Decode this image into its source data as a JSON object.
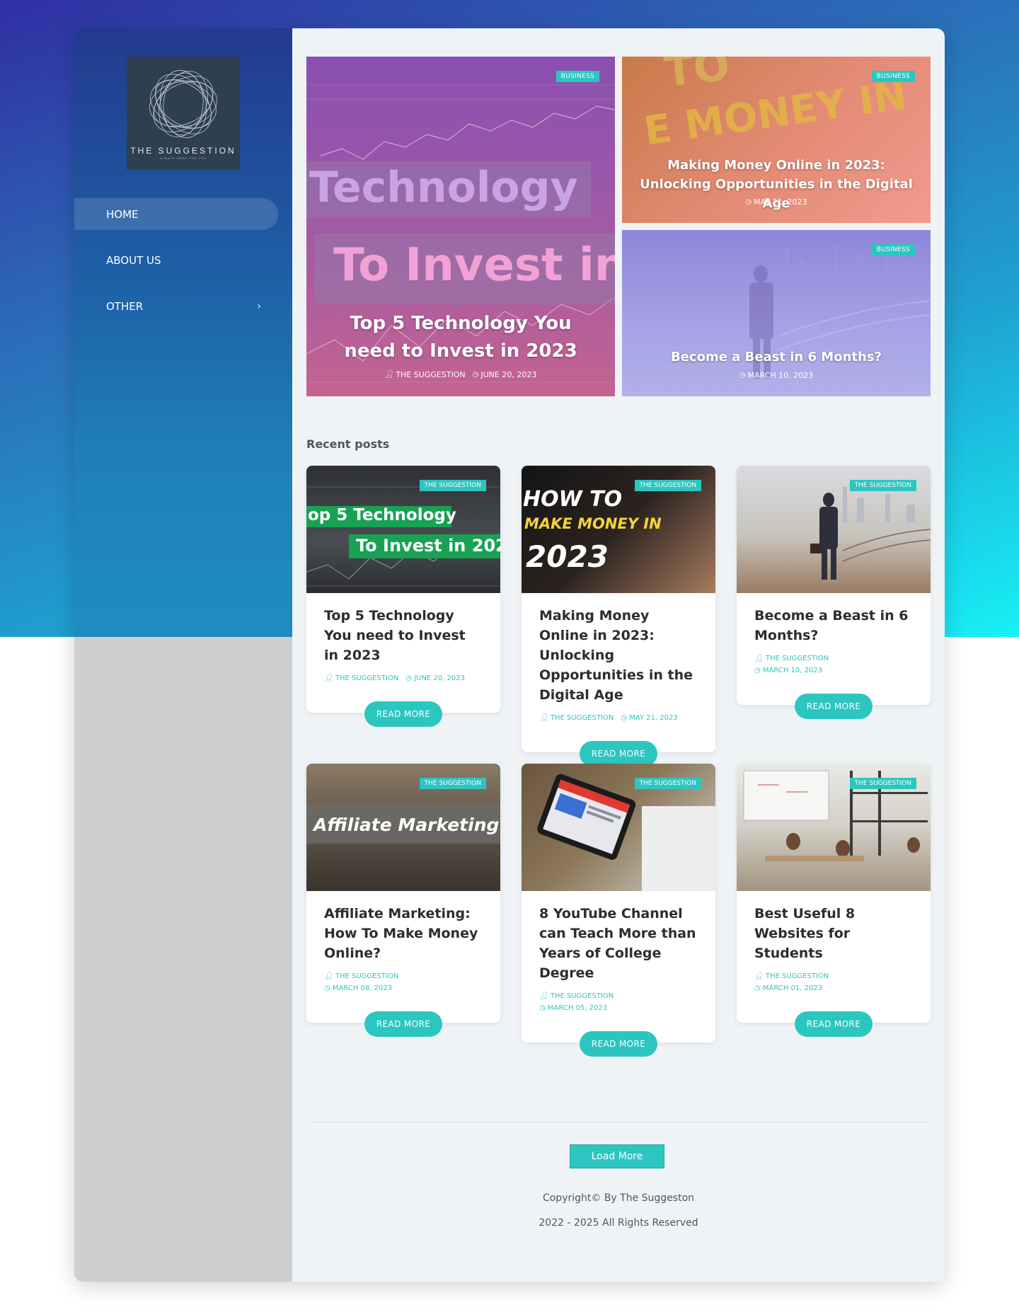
{
  "brand": {
    "logo_text": "THE SUGGESTION",
    "logo_tagline": "ALWAYS HERE FOR YOU"
  },
  "nav": {
    "items": [
      {
        "label": "HOME"
      },
      {
        "label": "ABOUT US"
      },
      {
        "label": "OTHER",
        "chevron": "›"
      }
    ]
  },
  "hero": {
    "big": {
      "badge": "BUSINESS",
      "image_words": [
        "Technology",
        "To Invest in"
      ],
      "title": "Top 5 Technology You need to Invest in 2023",
      "author": "THE SUGGESTION",
      "date": "JUNE 20, 2023"
    },
    "small1": {
      "badge": "BUSINESS",
      "image_words": [
        "TO",
        "E MONEY IN"
      ],
      "title": "Making Money Online in 2023: Unlocking Opportunities in the Digital Age",
      "date": "MAY 21, 2023"
    },
    "small2": {
      "badge": "BUSINESS",
      "title": "Become a Beast in 6 Months?",
      "date": "MARCH 10, 2023"
    }
  },
  "recent": {
    "heading": "Recent posts",
    "read_more_label": "READ MORE",
    "posts": [
      {
        "badge": "THE SUGGESTION",
        "image_words": [
          "op 5 Technology",
          "To Invest in 202"
        ],
        "title": "Top 5 Technology You need to Invest in 2023",
        "author": "THE SUGGESTION",
        "date": "JUNE 20, 2023"
      },
      {
        "badge": "THE SUGGESTION",
        "image_words": [
          "HOW TO",
          "MAKE MONEY IN",
          "2023"
        ],
        "title": "Making Money Online in 2023: Unlocking Opportunities in the Digital Age",
        "author": "THE SUGGESTION",
        "date": "MAY 21, 2023"
      },
      {
        "badge": "THE SUGGESTION",
        "title": "Become a Beast in 6 Months?",
        "author": "THE SUGGESTION",
        "date": "MARCH 10, 2023"
      },
      {
        "badge": "THE SUGGESTION",
        "image_words": [
          "Affiliate Marketing"
        ],
        "title": "Affiliate Marketing: How To Make Money Online?",
        "author": "THE SUGGESTION",
        "date": "MARCH 08, 2023"
      },
      {
        "badge": "THE SUGGESTION",
        "title": "8 YouTube Channel can Teach More than Years of College Degree",
        "author": "THE SUGGESTION",
        "date": "MARCH 05, 2023"
      },
      {
        "badge": "THE SUGGESTION",
        "title": "Best Useful 8 Websites for Students",
        "author": "THE SUGGESTION",
        "date": "MARCH 01, 2023"
      }
    ]
  },
  "load_more_label": "Load More",
  "footer": {
    "copyright": "Copyright© By The Suggeston",
    "rights": "2022 - 2025 All Rights Reserved"
  },
  "icons": {
    "user": "user-icon",
    "clock": "clock-icon",
    "chevron": "chevron-right-icon"
  },
  "colors": {
    "accent": "#2cc6c1",
    "sidebar_top": "#233a8e",
    "main_bg": "#eff3f6"
  }
}
